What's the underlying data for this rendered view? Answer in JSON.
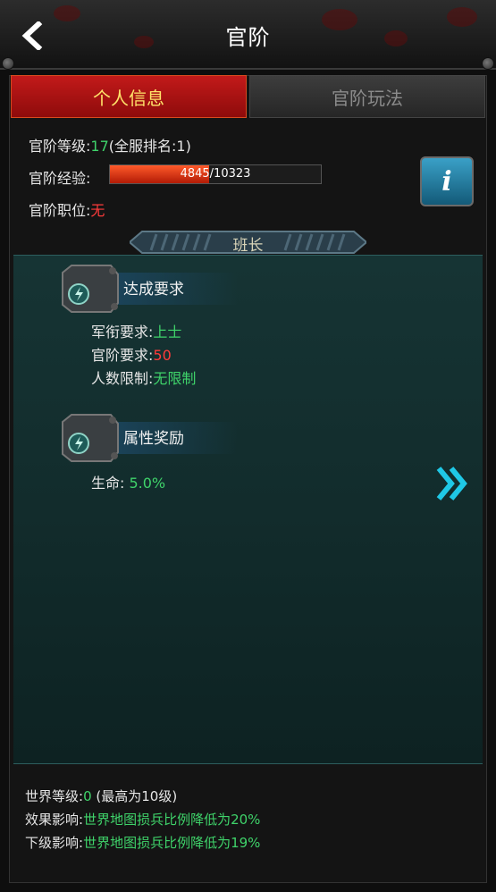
{
  "header": {
    "title": "官阶"
  },
  "tabs": {
    "personal_info": "个人信息",
    "rank_gameplay": "官阶玩法"
  },
  "info": {
    "rank_level_label": "官阶等级:",
    "rank_level_value": "17",
    "server_rank_text": "(全服排名:1)",
    "exp_label": "官阶经验:",
    "exp_current": "4845",
    "exp_max": "/10323",
    "exp_progress": 0.469,
    "position_label": "官阶职位:",
    "position_value": "无",
    "info_button_glyph": "i"
  },
  "rank_banner": {
    "name": "班长"
  },
  "requirements": {
    "title": "达成要求",
    "military_label": "军衔要求:",
    "military_value": "上士",
    "rank_label": "官阶要求:",
    "rank_value": "50",
    "headcount_label": "人数限制:",
    "headcount_value": "无限制"
  },
  "rewards": {
    "title": "属性奖励",
    "life_label": "生命: ",
    "life_value": "5.0%"
  },
  "footer": {
    "world_level_label": "世界等级:",
    "world_level_value": "0",
    "world_level_max": " (最高为10级)",
    "effect_label": "效果影响:",
    "effect_value": "世界地图损兵比例降低为20%",
    "sub_effect_label": "下级影响:",
    "sub_effect_value": "世界地图损兵比例降低为19%"
  },
  "icons": {
    "back": "chevron-left-icon",
    "info": "info-icon",
    "next": "double-chevron-right-icon",
    "badge": "lightning-emblem-icon"
  },
  "colors": {
    "accent_green": "#3fd36a",
    "accent_red": "#ff3b3b",
    "tab_active": "#c21a1a",
    "tab_active_text": "#ffe36a",
    "teal_bg": "#163434",
    "arrow_cyan": "#1fc8e6"
  }
}
